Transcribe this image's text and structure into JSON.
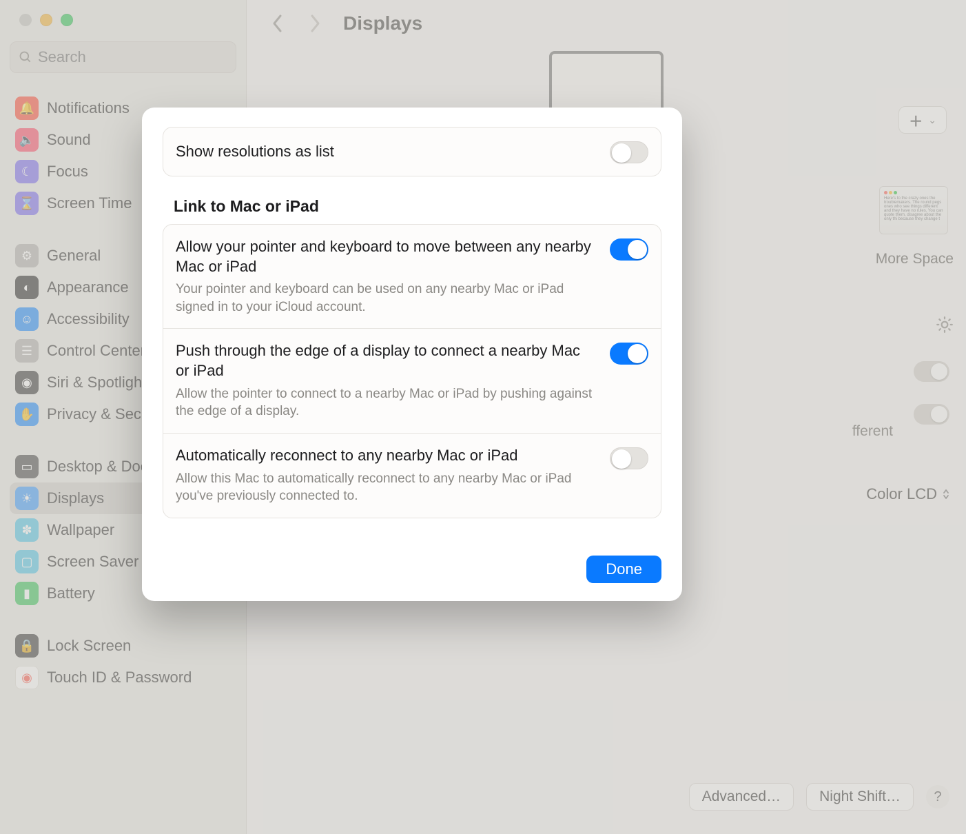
{
  "window": {
    "title": "Displays"
  },
  "search": {
    "placeholder": "Search"
  },
  "sidebar": {
    "groups": [
      {
        "items": [
          {
            "id": "notifications",
            "label": "Notifications",
            "icon": "bell-icon",
            "color": "#ff4e3a"
          },
          {
            "id": "sound",
            "label": "Sound",
            "icon": "speaker-icon",
            "color": "#ff4e6a"
          },
          {
            "id": "focus",
            "label": "Focus",
            "icon": "moon-icon",
            "color": "#7d6df2"
          },
          {
            "id": "screen-time",
            "label": "Screen Time",
            "icon": "hourglass-icon",
            "color": "#7d6df2"
          }
        ]
      },
      {
        "items": [
          {
            "id": "general",
            "label": "General",
            "icon": "gear-icon",
            "color": "#b4b2af"
          },
          {
            "id": "appearance",
            "label": "Appearance",
            "icon": "contrast-icon",
            "color": "#2c2c2c"
          },
          {
            "id": "accessibility",
            "label": "Accessibility",
            "icon": "person-icon",
            "color": "#1e8cff"
          },
          {
            "id": "control-center",
            "label": "Control Center",
            "icon": "sliders-icon",
            "color": "#b4b2af"
          },
          {
            "id": "siri-spotlight",
            "label": "Siri & Spotlight",
            "icon": "siri-icon",
            "color": "#3a3a3a"
          },
          {
            "id": "privacy",
            "label": "Privacy & Security",
            "icon": "hand-icon",
            "color": "#1e8cff"
          }
        ]
      },
      {
        "items": [
          {
            "id": "desktop-dock",
            "label": "Desktop & Dock",
            "icon": "dock-icon",
            "color": "#4a4a4a"
          },
          {
            "id": "displays",
            "label": "Displays",
            "active": true,
            "icon": "sun-icon",
            "color": "#3e9dff"
          },
          {
            "id": "wallpaper",
            "label": "Wallpaper",
            "icon": "flower-icon",
            "color": "#53c7e8"
          },
          {
            "id": "screen-saver",
            "label": "Screen Saver",
            "icon": "screensaver-icon",
            "color": "#53c7e8"
          },
          {
            "id": "battery",
            "label": "Battery",
            "icon": "battery-icon",
            "color": "#3bc55b"
          }
        ]
      },
      {
        "items": [
          {
            "id": "lock-screen",
            "label": "Lock Screen",
            "icon": "lock-icon",
            "color": "#3a3a3a"
          },
          {
            "id": "touch-id",
            "label": "Touch ID & Password",
            "icon": "fingerprint-icon",
            "color": "#fff",
            "textIcon": true
          }
        ]
      }
    ]
  },
  "background": {
    "more_space_label": "More Space",
    "partial_text": "fferent",
    "color_profile_label": "Color LCD",
    "advanced_button": "Advanced…",
    "night_shift_button": "Night Shift…",
    "help_label": "?"
  },
  "modal": {
    "show_resolutions_label": "Show resolutions as list",
    "show_resolutions_on": false,
    "section_title": "Link to Mac or iPad",
    "items": [
      {
        "id": "universal-control",
        "title": "Allow your pointer and keyboard to move between any nearby Mac or iPad",
        "desc": "Your pointer and keyboard can be used on any nearby Mac or iPad signed in to your iCloud account.",
        "on": true
      },
      {
        "id": "push-through",
        "title": "Push through the edge of a display to connect a nearby Mac or iPad",
        "desc": "Allow the pointer to connect to a nearby Mac or iPad by pushing against the edge of a display.",
        "on": true
      },
      {
        "id": "auto-reconnect",
        "title": "Automatically reconnect to any nearby Mac or iPad",
        "desc": "Allow this Mac to automatically reconnect to any nearby Mac or iPad you've previously connected to.",
        "on": false
      }
    ],
    "done_label": "Done"
  }
}
